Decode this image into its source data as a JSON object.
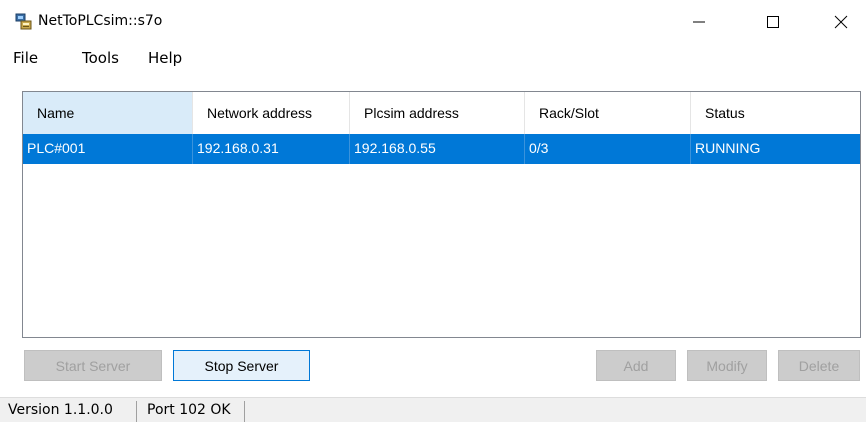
{
  "window": {
    "title": "NetToPLCsim::s7o",
    "app_icon": "netplc-app-icon",
    "controls": [
      "minimize-icon",
      "maximize-icon",
      "close-icon"
    ]
  },
  "menu": {
    "items": [
      {
        "label": "File"
      },
      {
        "label": "Tools"
      },
      {
        "label": "Help"
      }
    ]
  },
  "table": {
    "columns": [
      "Name",
      "Network address",
      "Plcsim address",
      "Rack/Slot",
      "Status"
    ],
    "rows": [
      {
        "name": "PLC#001",
        "network_address": "192.168.0.31",
        "plcsim_address": "192.168.0.55",
        "rack_slot": "0/3",
        "status": "RUNNING",
        "selected": true
      }
    ],
    "sorted_column": "Name"
  },
  "buttons": {
    "start_server": {
      "label": "Start Server",
      "enabled": false
    },
    "stop_server": {
      "label": "Stop Server",
      "enabled": true
    },
    "add": {
      "label": "Add",
      "enabled": false
    },
    "modify": {
      "label": "Modify",
      "enabled": false
    },
    "delete": {
      "label": "Delete",
      "enabled": false
    }
  },
  "status": {
    "version": "Version 1.1.0.0",
    "port": "Port 102 OK"
  },
  "colors": {
    "selection": "#0078d7",
    "header_sorted": "#d9ebf9"
  }
}
